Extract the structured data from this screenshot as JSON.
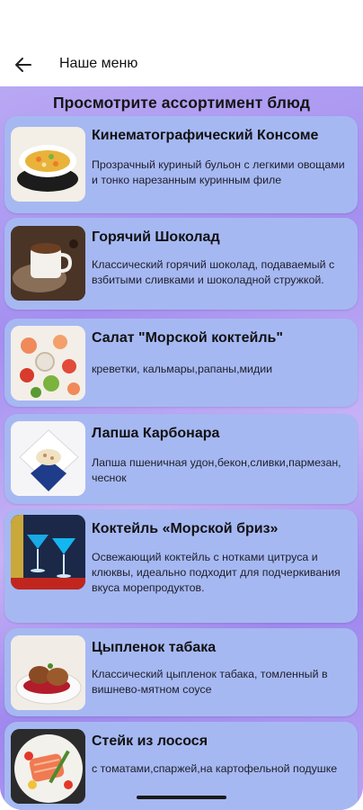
{
  "appbar": {
    "title": "Наше меню",
    "back_icon": "arrow-left-icon"
  },
  "main": {
    "heading": "Просмотрите ассортимент блюд",
    "dishes": [
      {
        "name": "Кинематографический Консоме",
        "description": "Прозрачный куриный бульон с легкими овощами и тонко нарезанным куринным филе",
        "image": "consomme-image"
      },
      {
        "name": "Горячий Шоколад",
        "description": "Классический горячий шоколад, подаваемый с взбитыми сливками и шоколадной стружкой.",
        "image": "hot-chocolate-image"
      },
      {
        "name": "Салат \"Морской коктейль\"",
        "description": "креветки, кальмары,рапаны,мидии",
        "image": "seafood-salad-image"
      },
      {
        "name": "Лапша Карбонара",
        "description": "Лапша пшеничная удон,бекон,сливки,пармезан, чеснок",
        "image": "carbonara-image"
      },
      {
        "name": "Коктейль «Морской бриз»",
        "description": "Освежающий коктейль с нотками цитруса и клюквы, идеально подходит для подчеркивания вкуса морепродуктов.",
        "image": "sea-breeze-cocktail-image"
      },
      {
        "name": "Цыпленок табака",
        "description": "Классический цыпленок табака, томленный в вишнево-мятном соусе",
        "image": "chicken-tabaka-image"
      },
      {
        "name": "Стейк из лосося",
        "description": "с томатами,спаржей,на картофельной подушке",
        "image": "salmon-steak-image"
      }
    ]
  }
}
